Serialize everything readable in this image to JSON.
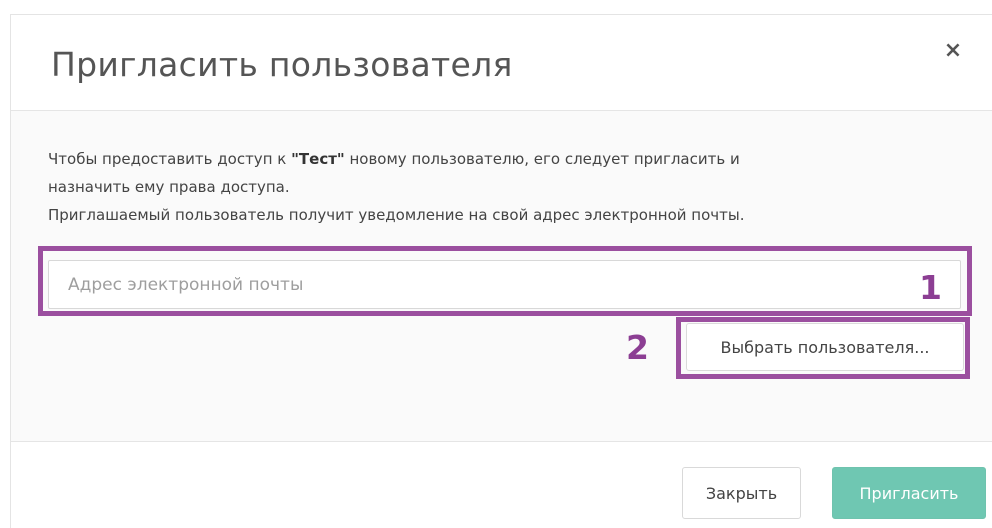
{
  "modal": {
    "title": "Пригласить пользователя",
    "close_symbol": "×"
  },
  "description": {
    "line1_before": "Чтобы предоставить доступ к ",
    "project_name": "\"Тест\"",
    "line1_after": " новому пользователю, его следует пригласить и",
    "line2": "назначить ему права доступа.",
    "line3": "Приглашаемый пользователь получит уведомление на свой адрес электронной почты."
  },
  "email": {
    "value": "",
    "placeholder": "Адрес электронной почты"
  },
  "select_user": {
    "label": "Выбрать пользователя..."
  },
  "annotations": {
    "marker_1": "1",
    "marker_2": "2",
    "color": "#9b4f9f"
  },
  "footer": {
    "close_label": "Закрыть",
    "invite_label": "Пригласить",
    "invite_color": "#6fc7b2"
  },
  "icons": {
    "close": "close-icon"
  }
}
